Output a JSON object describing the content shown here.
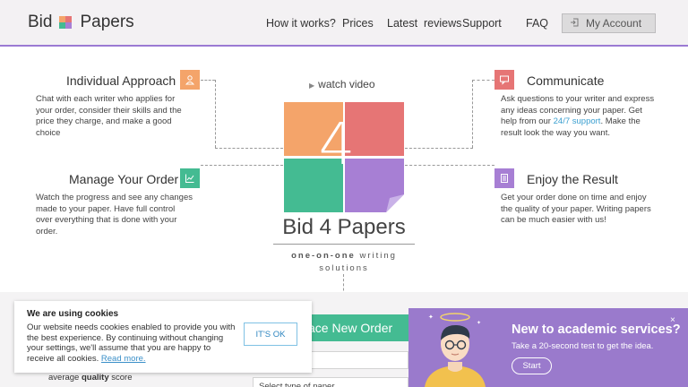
{
  "header": {
    "logo_left": "Bid",
    "logo_right": "Papers",
    "nav": [
      "How it works?",
      "Prices",
      "Latest  reviews",
      "Support",
      "FAQ"
    ],
    "account_label": "My Account",
    "account_icon": "sign-in-icon"
  },
  "features": {
    "individual": {
      "title": "Individual Approach",
      "text": "Chat with each writer who applies for your order, consider their skills and the price they charge, and make a good choice",
      "icon": "person-icon",
      "color": "#f4a46a"
    },
    "communicate": {
      "title": "Communicate",
      "text_before": "Ask questions to your writer and express any ideas concerning your paper. Get help from our ",
      "link": "24/7 support",
      "text_after": ". Make the result look the way you want.",
      "icon": "chat-icon",
      "color": "#e67575"
    },
    "manage": {
      "title": "Manage Your Order",
      "text": "Watch the progress and see any changes made to your paper. Have full control over everything that is done with your order.",
      "icon": "chart-icon",
      "color": "#44bb92"
    },
    "enjoy": {
      "title": "Enjoy the Result",
      "text": "Get your order done on time and enjoy the quality of your paper. Writing papers can be much easier with us!",
      "icon": "document-icon",
      "color": "#a77fd4"
    }
  },
  "center": {
    "video_label": "watch video",
    "numeral": "4",
    "brand": "Bid 4 Papers",
    "tagline_bold": "one-on-one",
    "tagline_rest": " writing solutions"
  },
  "order": {
    "button_label": "ace New Order",
    "select_placeholder": "Select type of paper",
    "quality_pre": "average ",
    "quality_bold": "quality",
    "quality_post": " score"
  },
  "cookie": {
    "title": "We are using cookies",
    "text": "Our website needs cookies enabled to provide you with the best experience. By continuing without changing your settings, we'll assume that you are happy to receive all cookies. ",
    "link": "Read more.",
    "ok_label": "IT'S OK"
  },
  "promo": {
    "title": "New to academic services?",
    "subtitle": "Take a 20-second test to get the idea.",
    "start_label": "Start",
    "close": "×"
  },
  "colors": {
    "orange": "#f4a46a",
    "red": "#e67575",
    "green": "#44bb92",
    "purple": "#a77fd4"
  }
}
